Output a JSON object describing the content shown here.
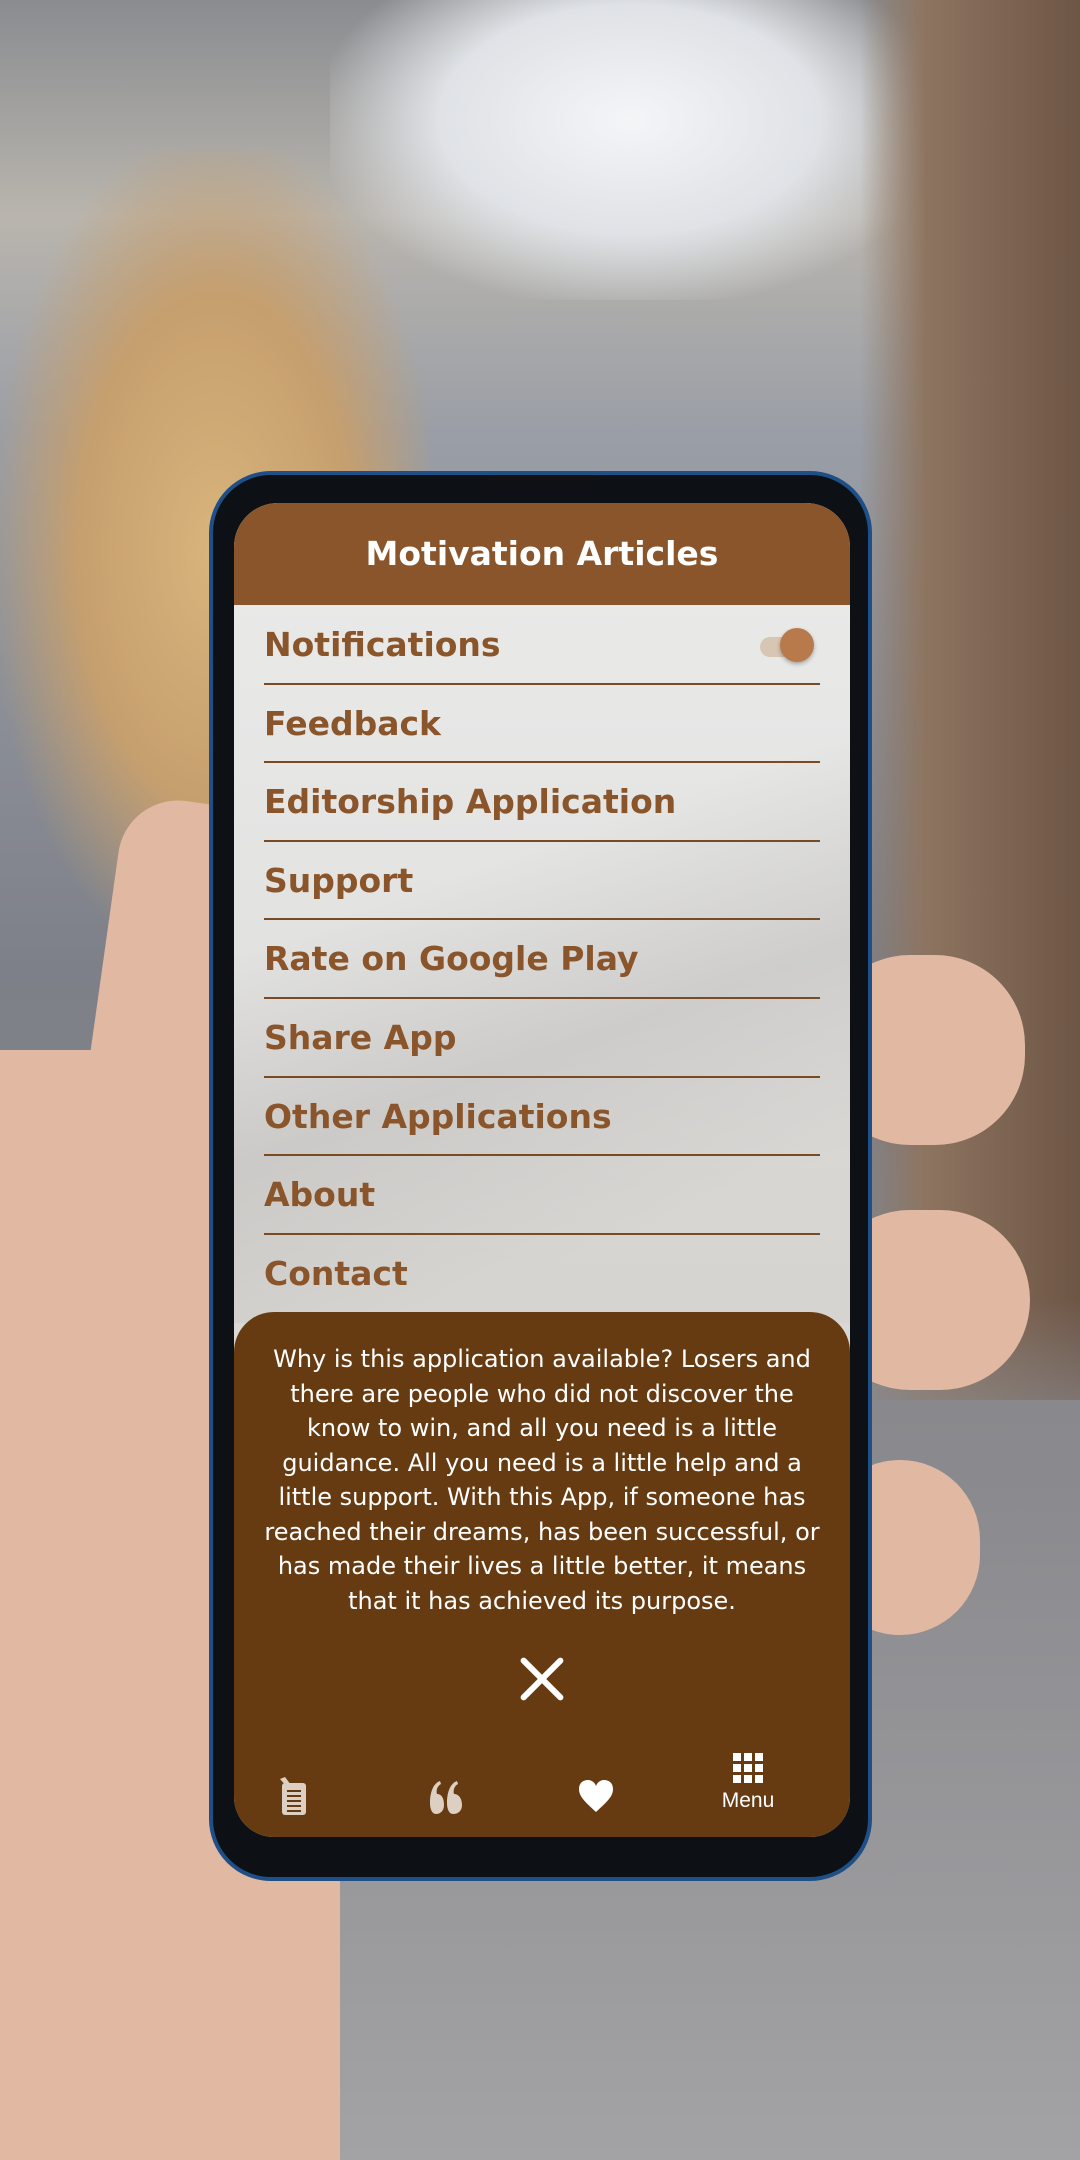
{
  "app": {
    "title": "Motivation Articles"
  },
  "menu": {
    "items": [
      {
        "label": "Notifications",
        "toggle_on": true
      },
      {
        "label": "Feedback"
      },
      {
        "label": "Editorship Application"
      },
      {
        "label": "Support"
      },
      {
        "label": "Rate on Google Play"
      },
      {
        "label": "Share App"
      },
      {
        "label": "Other Applications"
      },
      {
        "label": "About"
      },
      {
        "label": "Contact"
      }
    ]
  },
  "about_sheet": {
    "text": "Why is this application available? Losers and there are people who did not discover the know to win, and all you need is a little guidance. All you need is a little help and a little support. With this App, if someone has reached their dreams, has been successful, or has made their lives a little better, it means that it has achieved its purpose.",
    "close_icon": "close-x-icon"
  },
  "bottom_nav": {
    "items": [
      {
        "icon": "article-icon",
        "label": ""
      },
      {
        "icon": "quote-icon",
        "label": ""
      },
      {
        "icon": "heart-icon",
        "label": ""
      },
      {
        "icon": "grid-menu-icon",
        "label": "Menu"
      }
    ]
  },
  "colors": {
    "header": "#8a552a",
    "sheet": "#673b12",
    "text_brown": "#8a552a"
  }
}
